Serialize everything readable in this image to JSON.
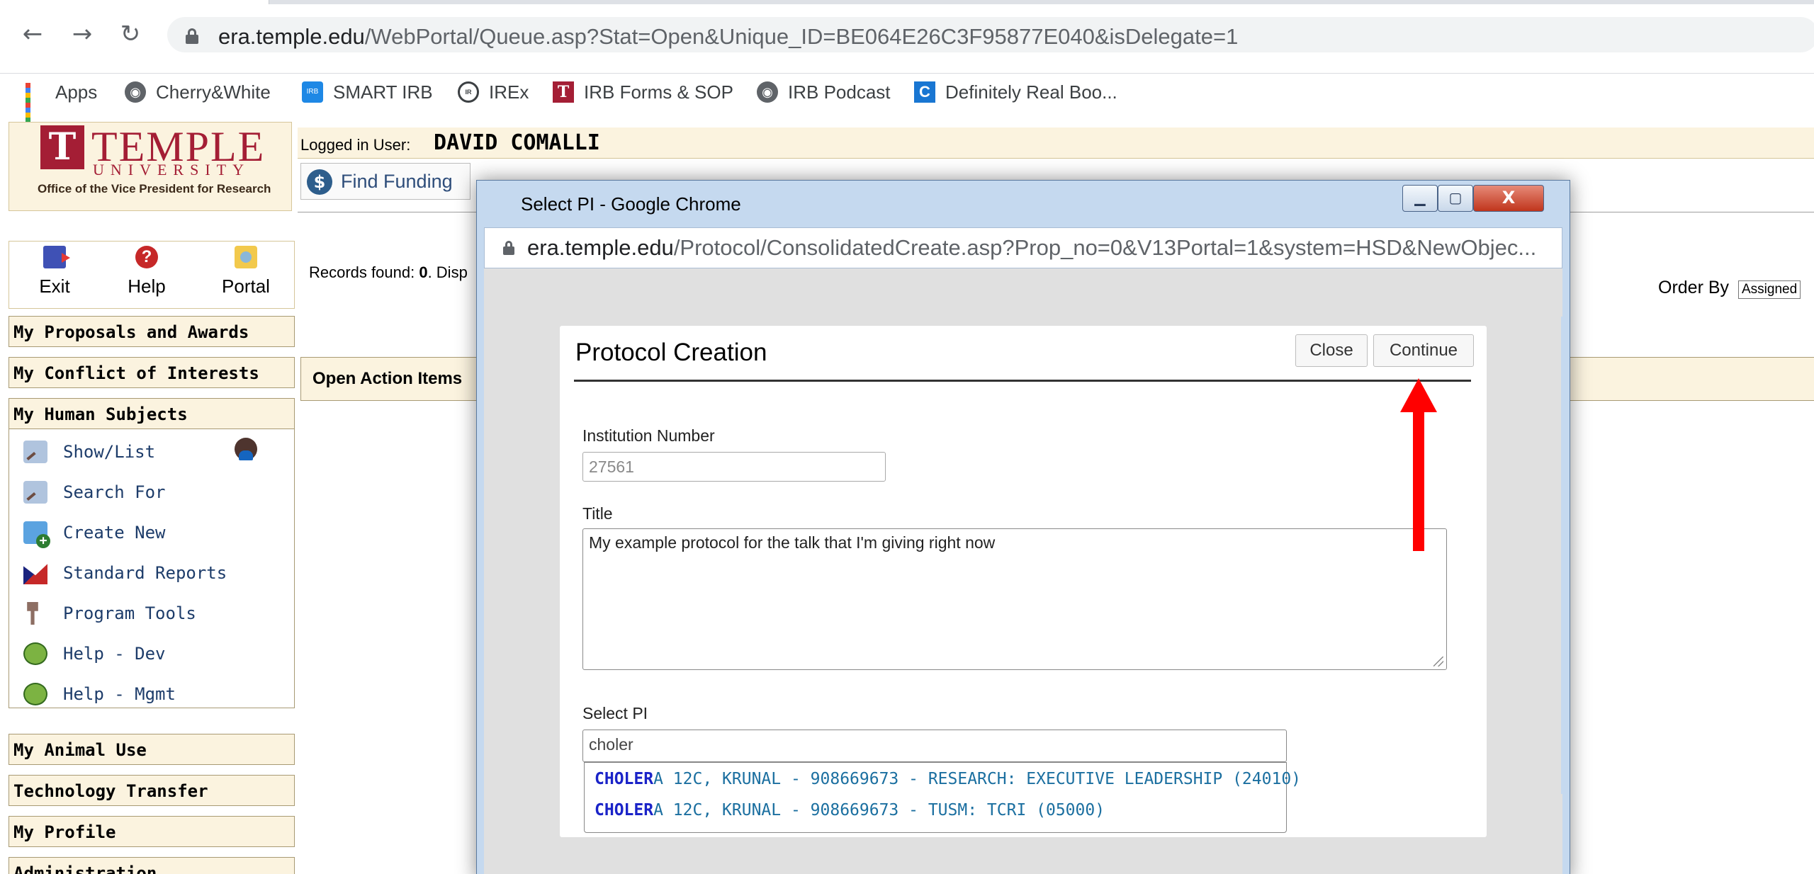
{
  "browser": {
    "url_host": "era.temple.edu",
    "url_path": "/WebPortal/Queue.asp?Stat=Open&Unique_ID=BE064E26C3F95877E040&isDelegate=1",
    "bookmarks": [
      {
        "label": "Apps",
        "icon": "apps-grid-icon"
      },
      {
        "label": "Cherry&White",
        "icon": "globe-icon"
      },
      {
        "label": "SMART IRB",
        "icon": "smart-irb-icon"
      },
      {
        "label": "IREx",
        "icon": "irex-icon"
      },
      {
        "label": "IRB Forms & SOP",
        "icon": "temple-t-icon"
      },
      {
        "label": "IRB Podcast",
        "icon": "globe-icon"
      },
      {
        "label": "Definitely Real Boo...",
        "icon": "c-icon"
      }
    ]
  },
  "header": {
    "logo_temple": "TEMPLE",
    "logo_university": "UNIVERSITY",
    "logo_office": "Office of the Vice President for Research",
    "logged_in_label": "Logged in User:",
    "user_name": "DAVID COMALLI",
    "find_funding": "Find Funding"
  },
  "sidebar": {
    "icons": [
      {
        "label": "Exit",
        "icon": "exit-icon"
      },
      {
        "label": "Help",
        "icon": "help-icon"
      },
      {
        "label": "Portal",
        "icon": "portal-icon"
      }
    ],
    "sections": {
      "proposals": "My Proposals and Awards",
      "conflict": "My Conflict of Interests",
      "human": "My Human Subjects",
      "animal": "My Animal Use",
      "tech": "Technology Transfer",
      "profile": "My Profile",
      "admin": "Administration"
    },
    "human_items": [
      {
        "label": "Show/List",
        "icon": "magnifier-icon"
      },
      {
        "label": "Search For",
        "icon": "magnifier-icon"
      },
      {
        "label": "Create New",
        "icon": "create-new-icon"
      },
      {
        "label": "Standard Reports",
        "icon": "reports-icon"
      },
      {
        "label": "Program Tools",
        "icon": "tools-icon"
      },
      {
        "label": "Help - Dev",
        "icon": "help-globe-icon"
      },
      {
        "label": "Help - Mgmt",
        "icon": "help-globe-icon"
      }
    ]
  },
  "main": {
    "records_found_prefix": "Records found: ",
    "records_count": "0",
    "records_suffix": ". Disp",
    "order_by_label": "Order By",
    "order_by_value": "Assigned",
    "open_action_items": "Open Action Items"
  },
  "popup": {
    "window_title": "Select PI - Google Chrome",
    "url_host": "era.temple.edu",
    "url_path": "/Protocol/ConsolidatedCreate.asp?Prop_no=0&V13Portal=1&system=HSD&NewObjec..."
  },
  "dialog": {
    "title": "Protocol Creation",
    "close_label": "Close",
    "continue_label": "Continue",
    "institution_label": "Institution Number",
    "institution_value": "27561",
    "title_label": "Title",
    "title_value": "My example protocol for the talk that I'm giving right now",
    "pi_label": "Select PI",
    "pi_value": "choler",
    "suggestions": [
      {
        "match": "CHOLER",
        "rest": "A 12C, KRUNAL - 908669673 - RESEARCH: EXECUTIVE LEADERSHIP (24010)"
      },
      {
        "match": "CHOLER",
        "rest": "A 12C, KRUNAL - 908669673 - TUSM: TCRI (05000)"
      }
    ]
  },
  "colors": {
    "temple_red": "#a41e35",
    "section_bg": "#fbf3df",
    "annotation_arrow": "#ff0000",
    "link_blue": "#1b6fa0"
  }
}
